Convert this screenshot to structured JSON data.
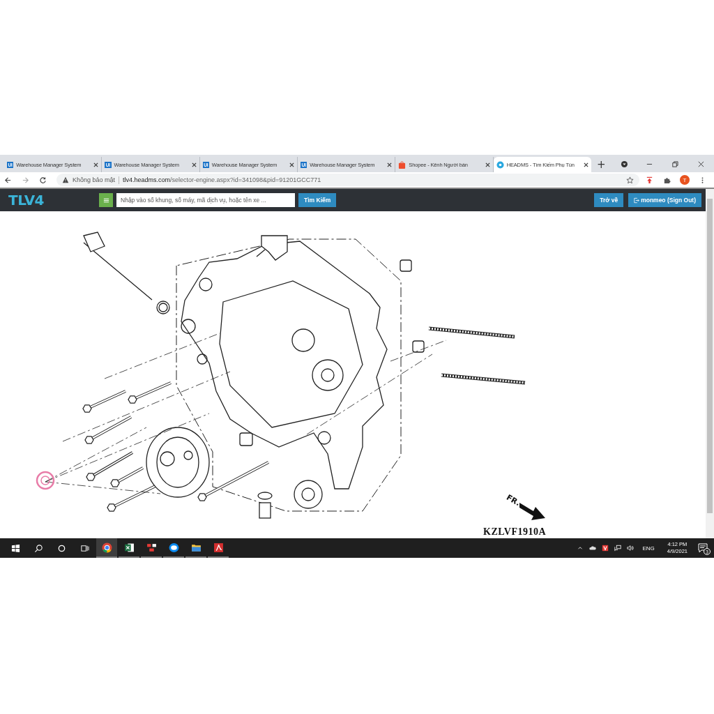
{
  "browser": {
    "tabs": [
      {
        "label": "Warehouse Manager System",
        "kind": "ui",
        "favicon_text": "UI",
        "selected": false
      },
      {
        "label": "Warehouse Manager System",
        "kind": "ui",
        "favicon_text": "UI",
        "selected": false
      },
      {
        "label": "Warehouse Manager System",
        "kind": "ui",
        "favicon_text": "UI",
        "selected": false
      },
      {
        "label": "Warehouse Manager System",
        "kind": "ui",
        "favicon_text": "UI",
        "selected": false
      },
      {
        "label": "Shopee - Kênh Người bán",
        "kind": "shopee",
        "selected": false
      },
      {
        "label": "HEADMS - Tìm Kiếm Phụ Tùn",
        "kind": "headms",
        "selected": true
      }
    ],
    "new_tab": "+",
    "security": "Không bảo mật",
    "url_host": "tlv4.headms.com",
    "url_path": "/selector-engine.aspx?id=341098&pid=91201GCC771",
    "profile": "T"
  },
  "app": {
    "logo": "TLV4",
    "search": {
      "placeholder": "Nhập vào số khung, số máy, mã dịch vụ, hoặc tên xe ..."
    },
    "search_button": "Tìm Kiếm",
    "back_button": "Trở về",
    "signout_button": "monmeo (Sign Out)"
  },
  "diagram": {
    "direction_label": "FR.",
    "code": "KZLVF1910A"
  },
  "taskbar": {
    "apps": [
      {
        "kind": "chrome",
        "active": true
      },
      {
        "kind": "excel",
        "active": false
      },
      {
        "kind": "app",
        "active": false
      },
      {
        "kind": "zalo",
        "active": false
      },
      {
        "kind": "explorer",
        "active": false
      },
      {
        "kind": "pdf",
        "active": false
      }
    ],
    "language": "ENG",
    "time": "4:12 PM",
    "date": "4/9/2021",
    "notifications": "3"
  }
}
